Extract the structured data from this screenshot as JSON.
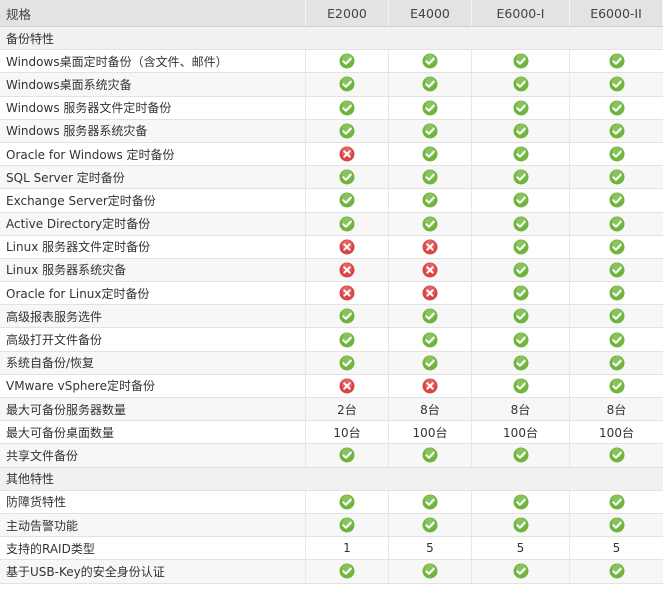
{
  "colors": {
    "check": "#6fb53b",
    "cross": "#d94545"
  },
  "header": [
    "规格",
    "E2000",
    "E4000",
    "E6000-I",
    "E6000-II"
  ],
  "rows": [
    {
      "type": "section",
      "label": "备份特性"
    },
    {
      "type": "feature",
      "label": "Windows桌面定时备份（含文件、邮件）",
      "values": [
        "check",
        "check",
        "check",
        "check"
      ]
    },
    {
      "type": "feature",
      "label": "Windows桌面系统灾备",
      "values": [
        "check",
        "check",
        "check",
        "check"
      ]
    },
    {
      "type": "feature",
      "label": "Windows 服务器文件定时备份",
      "values": [
        "check",
        "check",
        "check",
        "check"
      ]
    },
    {
      "type": "feature",
      "label": "Windows 服务器系统灾备",
      "values": [
        "check",
        "check",
        "check",
        "check"
      ]
    },
    {
      "type": "feature",
      "label": "Oracle for Windows 定时备份",
      "values": [
        "cross",
        "check",
        "check",
        "check"
      ]
    },
    {
      "type": "feature",
      "label": "SQL Server 定时备份",
      "values": [
        "check",
        "check",
        "check",
        "check"
      ]
    },
    {
      "type": "feature",
      "label": "Exchange Server定时备份",
      "values": [
        "check",
        "check",
        "check",
        "check"
      ]
    },
    {
      "type": "feature",
      "label": "Active Directory定时备份",
      "values": [
        "check",
        "check",
        "check",
        "check"
      ]
    },
    {
      "type": "feature",
      "label": "Linux 服务器文件定时备份",
      "values": [
        "cross",
        "cross",
        "check",
        "check"
      ]
    },
    {
      "type": "feature",
      "label": "Linux 服务器系统灾备",
      "values": [
        "cross",
        "cross",
        "check",
        "check"
      ]
    },
    {
      "type": "feature",
      "label": "Oracle for Linux定时备份",
      "values": [
        "cross",
        "cross",
        "check",
        "check"
      ]
    },
    {
      "type": "feature",
      "label": "高级报表服务选件",
      "values": [
        "check",
        "check",
        "check",
        "check"
      ]
    },
    {
      "type": "feature",
      "label": "高级打开文件备份",
      "values": [
        "check",
        "check",
        "check",
        "check"
      ]
    },
    {
      "type": "feature",
      "label": "系统自备份/恢复",
      "values": [
        "check",
        "check",
        "check",
        "check"
      ]
    },
    {
      "type": "feature",
      "label": "VMware vSphere定时备份",
      "values": [
        "cross",
        "cross",
        "check",
        "check"
      ]
    },
    {
      "type": "feature",
      "label": "最大可备份服务器数量",
      "values": [
        "2台",
        "8台",
        "8台",
        "8台"
      ]
    },
    {
      "type": "feature",
      "label": "最大可备份桌面数量",
      "values": [
        "10台",
        "100台",
        "100台",
        "100台"
      ]
    },
    {
      "type": "feature",
      "label": "共享文件备份",
      "values": [
        "check",
        "check",
        "check",
        "check"
      ]
    },
    {
      "type": "section",
      "label": "其他特性"
    },
    {
      "type": "feature",
      "label": "防障货特性",
      "values": [
        "check",
        "check",
        "check",
        "check"
      ]
    },
    {
      "type": "feature",
      "label": "主动告警功能",
      "values": [
        "check",
        "check",
        "check",
        "check"
      ]
    },
    {
      "type": "feature",
      "label": "支持的RAID类型",
      "values": [
        "1",
        "5",
        "5",
        "5"
      ]
    },
    {
      "type": "feature",
      "label": "基于USB-Key的安全身份认证",
      "values": [
        "check",
        "check",
        "check",
        "check"
      ]
    }
  ]
}
